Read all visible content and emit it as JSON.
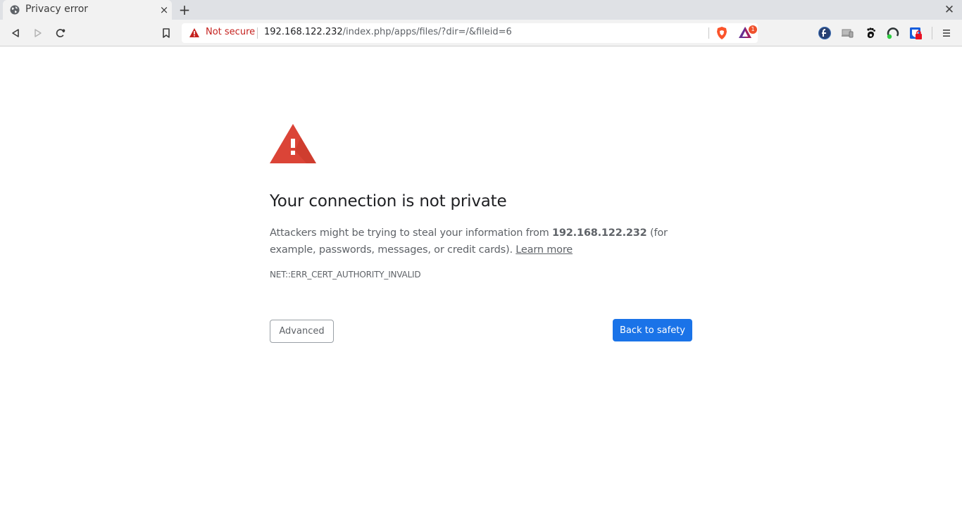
{
  "browser": {
    "tab": {
      "title": "Privacy error",
      "favicon": "globe-icon",
      "close_label": "×"
    },
    "new_tab_label": "+",
    "window_close_label": "✕",
    "toolbar": {
      "back": "back-icon",
      "forward": "forward-icon",
      "reload": "reload-icon",
      "bookmark": "bookmark-icon"
    },
    "omnibox": {
      "security_label": "Not secure",
      "url_host": "192.168.122.232",
      "url_path": "/index.php/apps/files/?dir=/&fileid=6"
    },
    "brave_rewards_badge": "1",
    "extensions": [
      "fedora-icon",
      "desktop-device-icon",
      "gnome-foot-icon",
      "refresh-sync-icon",
      "bitwarden-lock-icon"
    ],
    "menu": "hamburger-menu-icon"
  },
  "interstitial": {
    "heading": "Your connection is not private",
    "body_prefix": "Attackers might be trying to steal your information from ",
    "body_host": "192.168.122.232",
    "body_suffix": " (for example, passwords, messages, or credit cards). ",
    "learn_more": "Learn more",
    "error_code": "NET::ERR_CERT_AUTHORITY_INVALID",
    "advanced_label": "Advanced",
    "back_to_safety_label": "Back to safety"
  },
  "colors": {
    "warning_red": "#db4437",
    "not_secure_red": "#c5221f",
    "primary_blue": "#1a73e8"
  }
}
